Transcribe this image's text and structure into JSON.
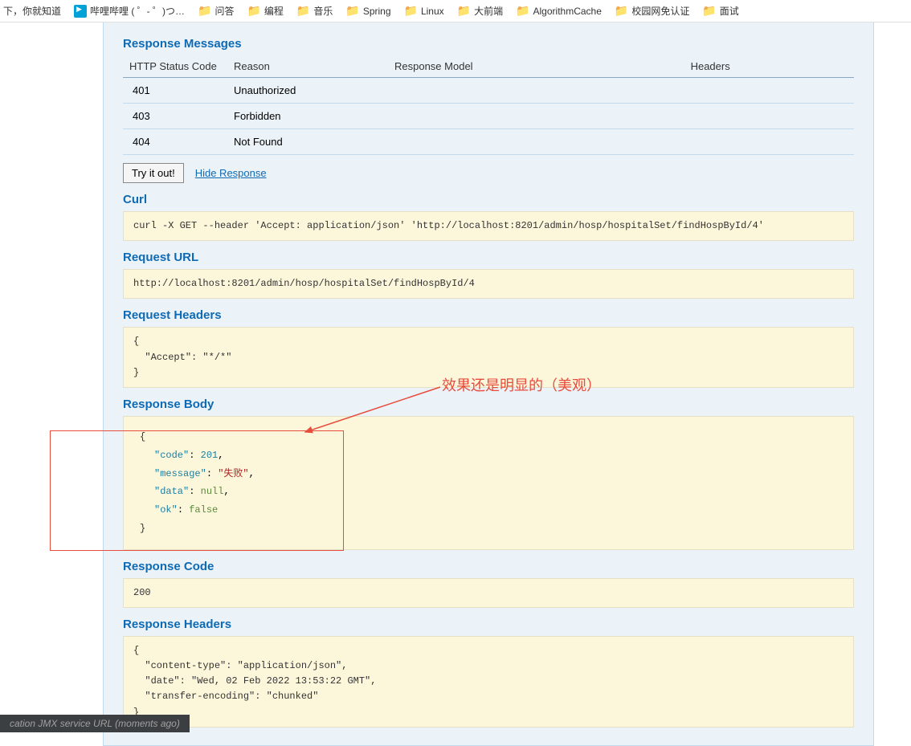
{
  "bookmarks": {
    "prefix": "下，你就知道",
    "bilibili": "哔哩哔哩 ( ゜- ゜)つ…",
    "items": [
      "问答",
      "编程",
      "音乐",
      "Spring",
      "Linux",
      "大前端",
      "AlgorithmCache",
      "校园网免认证",
      "面试"
    ]
  },
  "sections": {
    "response_messages_title": "Response Messages",
    "curl_title": "Curl",
    "request_url_title": "Request URL",
    "request_headers_title": "Request Headers",
    "response_body_title": "Response Body",
    "response_code_title": "Response Code",
    "response_headers_title": "Response Headers"
  },
  "response_messages": {
    "headers": {
      "status": "HTTP Status Code",
      "reason": "Reason",
      "model": "Response Model",
      "headers_col": "Headers"
    },
    "rows": [
      {
        "code": "401",
        "reason": "Unauthorized"
      },
      {
        "code": "403",
        "reason": "Forbidden"
      },
      {
        "code": "404",
        "reason": "Not Found"
      }
    ]
  },
  "try_it": {
    "button": "Try it out!",
    "hide_link": "Hide Response"
  },
  "curl_text": "curl -X GET --header 'Accept: application/json' 'http://localhost:8201/admin/hosp/hospitalSet/findHospById/4'",
  "request_url_text": "http://localhost:8201/admin/hosp/hospitalSet/findHospById/4",
  "request_headers_text": "{\n  \"Accept\": \"*/*\"\n}",
  "response_body_json": {
    "code_key": "\"code\"",
    "code_val": "201",
    "message_key": "\"message\"",
    "message_val": "\"失败\"",
    "data_key": "\"data\"",
    "data_val": "null",
    "ok_key": "\"ok\"",
    "ok_val": "false"
  },
  "response_code_text": "200",
  "response_headers_text": "{\n  \"content-type\": \"application/json\",\n  \"date\": \"Wed, 02 Feb 2022 13:53:22 GMT\",\n  \"transfer-encoding\": \"chunked\"\n}",
  "annotation_text": "效果还是明显的（美观）",
  "status_bar": "cation JMX service URL (moments ago)"
}
